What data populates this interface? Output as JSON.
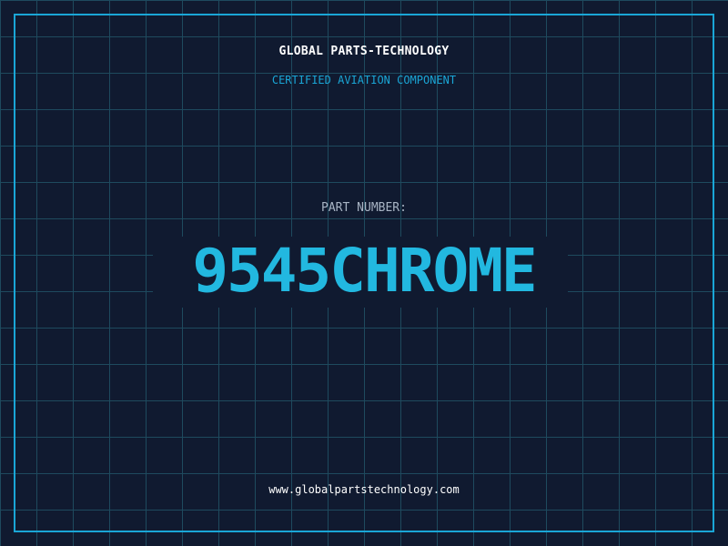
{
  "header": {
    "company_name": "GLOBAL PARTS-TECHNOLOGY",
    "subtitle": "CERTIFIED AVIATION COMPONENT"
  },
  "part": {
    "label": "PART NUMBER:",
    "number": "9545CHROME"
  },
  "footer": {
    "website": "www.globalpartstechnology.com"
  },
  "colors": {
    "background": "#101a30",
    "grid": "#1e4a5e",
    "accent": "#1aa6d6",
    "part_number": "#22b8e0",
    "label": "#a8b4c4",
    "text": "#ffffff"
  }
}
